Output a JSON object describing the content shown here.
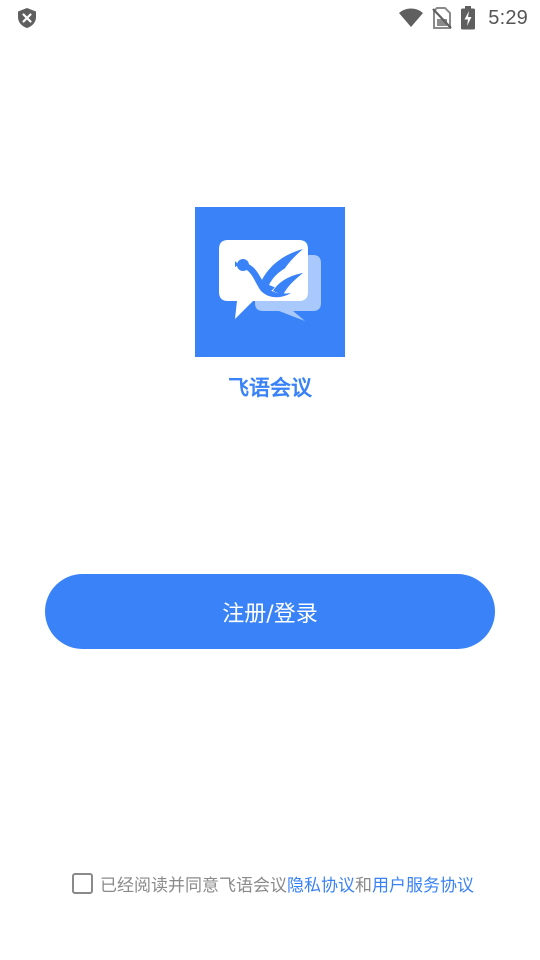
{
  "status_bar": {
    "time": "5:29",
    "icons": [
      "shield-x-icon",
      "wifi-icon",
      "no-sim-icon",
      "battery-charging-icon"
    ]
  },
  "app": {
    "name": "飞语会议",
    "logo_icon": "bird-chat-bubble-logo-icon",
    "brand_color": "#3a82f7"
  },
  "login_button": {
    "label": "注册/登录"
  },
  "agreement": {
    "checked": false,
    "prefix": "已经阅读并同意飞语会议",
    "privacy_link": "隐私协议",
    "conjunction": "和",
    "service_link": "用户服务协议"
  }
}
